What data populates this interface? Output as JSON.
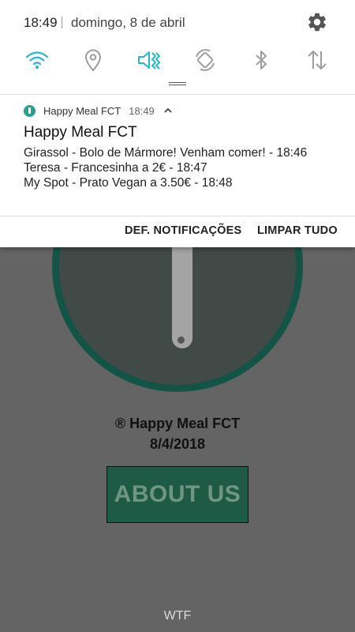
{
  "status": {
    "time": "18:49",
    "date": "domingo, 8 de abril",
    "settings_icon": "gear-icon"
  },
  "quick_settings": [
    {
      "name": "wifi",
      "icon": "wifi-icon",
      "active": true
    },
    {
      "name": "location",
      "icon": "location-icon",
      "active": false
    },
    {
      "name": "vibrate",
      "icon": "vibrate-icon",
      "active": true
    },
    {
      "name": "auto-rotate",
      "icon": "rotate-icon",
      "active": false
    },
    {
      "name": "bluetooth",
      "icon": "bluetooth-icon",
      "active": false
    },
    {
      "name": "mobile-data",
      "icon": "data-arrows-icon",
      "active": false
    }
  ],
  "notification": {
    "app_name": "Happy Meal FCT",
    "time": "18:49",
    "title": "Happy Meal FCT",
    "lines": [
      "Girassol - Bolo de Mármore! Venham comer! - 18:46",
      "Teresa - Francesinha a 2€ - 18:47",
      "My Spot - Prato Vegan a 3.50€ - 18:48"
    ],
    "actions": {
      "settings": "DEF. NOTIFICAÇÕES",
      "clear": "LIMPAR TUDO"
    }
  },
  "app": {
    "copyright": "® Happy Meal FCT",
    "date": "8/4/2018",
    "about_button": "ABOUT US",
    "footer": "WTF"
  },
  "colors": {
    "accent_active": "#29b6d0",
    "icon_inactive": "#9e9e9e",
    "app_green": "#1e5a45",
    "dial_ring": "#145447"
  }
}
